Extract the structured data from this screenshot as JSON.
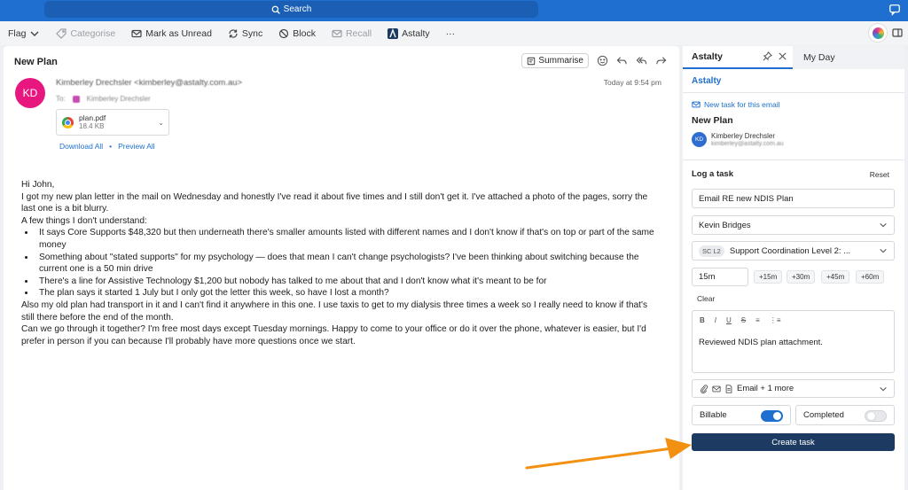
{
  "topbar": {
    "search_label": "Search"
  },
  "toolbar": {
    "flag": "Flag",
    "categorise": "Categorise",
    "mark_unread": "Mark as Unread",
    "sync": "Sync",
    "block": "Block",
    "recall": "Recall",
    "astalty": "Astalty",
    "more": "···"
  },
  "message": {
    "subject": "New Plan",
    "summarise": "Summarise",
    "avatar_initials": "KD",
    "sender": "Kimberley Drechsler <kimberley@astalty.com.au>",
    "to_label": "To:",
    "to_name": "Kimberley Drechsler",
    "timestamp": "Today at 9:54 pm",
    "attachment": {
      "name": "plan.pdf",
      "size": "18.4 KB"
    },
    "download_all": "Download All",
    "preview_all": "Preview All",
    "body": {
      "greeting": "Hi John,",
      "p1": "I got my new plan letter in the mail on Wednesday and honestly I've read it about five times and I still don't get it. I've attached a photo of the pages, sorry the last one is a bit blurry.",
      "p2": "A few things I don't understand:",
      "bullets": [
        "It says Core Supports $48,320 but then underneath there's smaller amounts listed with different names and I don't know if that's on top or part of the same money",
        "Something about \"stated supports\" for my psychology — does that mean I can't change psychologists? I've been thinking about switching because the current one is a 50 min drive",
        "There's a line for Assistive Technology $1,200 but nobody has talked to me about that and I don't know what it's meant to be for",
        "The plan says it started 1 July but I only got the letter this week, so have I lost a month?"
      ],
      "p3": "Also my old plan had transport in it and I can't find it anywhere in this one. I use taxis to get to my dialysis three times a week so I really need to know if that's still there before the end of the month.",
      "p4": "Can we go through it together? I'm free most days except Tuesday mornings. Happy to come to your office or do it over the phone, whatever is easier, but I'd prefer in person if you can because I'll probably have more questions once we start."
    }
  },
  "panel": {
    "tab_active": "Astalty",
    "tab_other": "My Day",
    "brand": "Astalty",
    "new_task_link": "New task for this email",
    "task_subject": "New Plan",
    "contact": {
      "initials": "KD",
      "name": "Kimberley Drechsler",
      "email": "kimberley@astalty.com.au"
    },
    "log_task": "Log a task",
    "reset": "Reset",
    "title_value": "Email RE new NDIS Plan",
    "assignee": "Kevin Bridges",
    "service_code": "SC L2",
    "service_name": "Support Coordination Level 2: ...",
    "duration": "15m",
    "chips": [
      "+15m",
      "+30m",
      "+45m",
      "+60m"
    ],
    "clear": "Clear",
    "editor_tools": [
      "B",
      "I",
      "U",
      "S",
      "≡",
      "⋮≡"
    ],
    "notes": "Reviewed NDIS plan attachment.",
    "attach_summary": "Email + 1 more",
    "billable": "Billable",
    "billable_on": true,
    "completed": "Completed",
    "completed_on": false,
    "create": "Create task"
  },
  "colors": {
    "accent": "#1e6fcf",
    "avatar": "#e8177f",
    "create_button": "#1d3a63",
    "arrow": "#f29111"
  }
}
